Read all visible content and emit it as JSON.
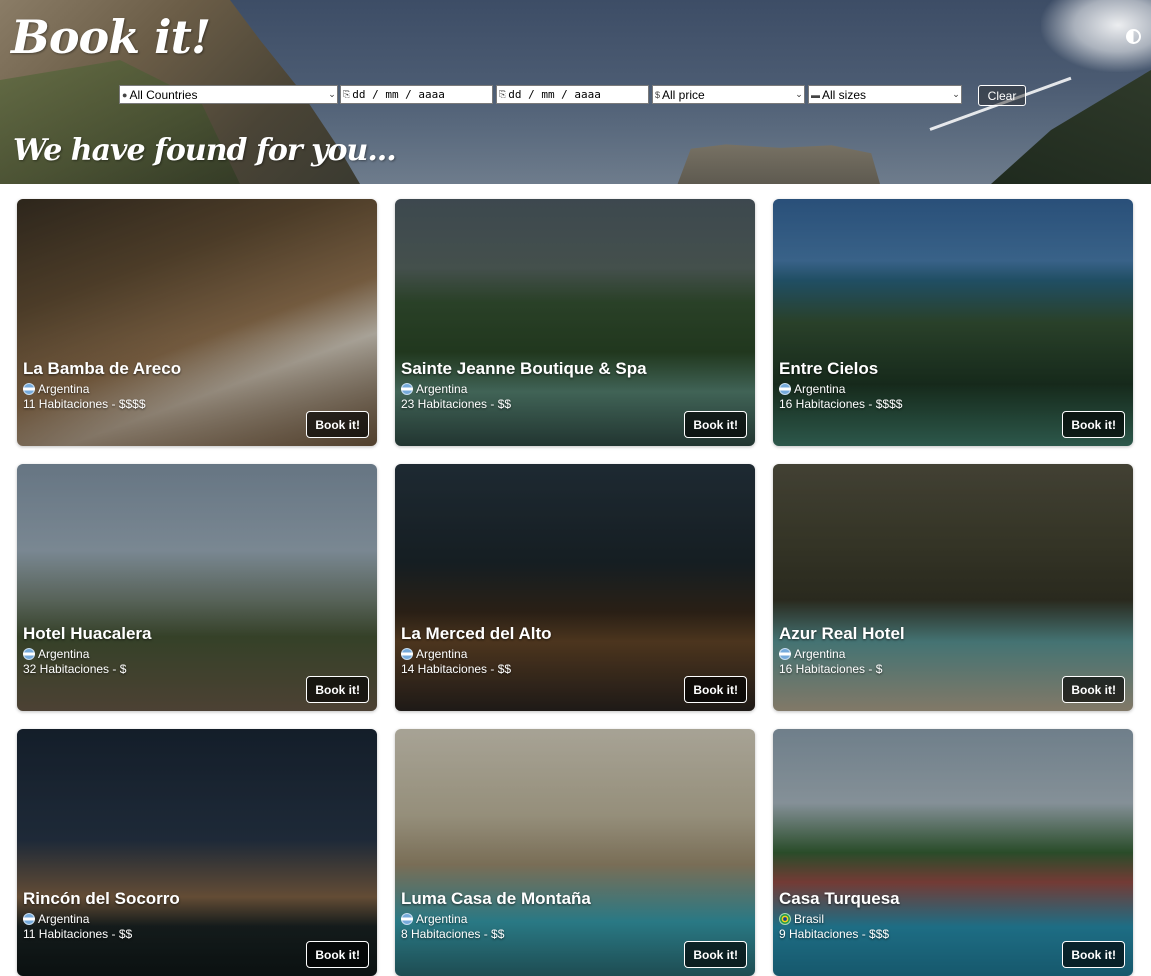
{
  "header": {
    "logo": "Book it!",
    "subtitle": "We have found for you...",
    "theme_toggle_icon": "contrast-icon"
  },
  "filters": {
    "country": {
      "value": "All Countries",
      "icon": "map-pin-icon"
    },
    "checkin": {
      "placeholder": "dd / mm / aaaa",
      "icon": "door-in-icon"
    },
    "checkout": {
      "placeholder": "dd / mm / aaaa",
      "icon": "door-out-icon"
    },
    "price": {
      "value": "All price",
      "icon": "dollar-icon"
    },
    "size": {
      "value": "All sizes",
      "icon": "bed-icon"
    },
    "clear_label": "Clear"
  },
  "hotels": [
    {
      "name": "La Bamba de Areco",
      "country": "Argentina",
      "flag": "argentina-flag-icon",
      "info": "11 Habitaciones - $$$$",
      "cta": "Book it!"
    },
    {
      "name": "Sainte Jeanne Boutique & Spa",
      "country": "Argentina",
      "flag": "argentina-flag-icon",
      "info": "23 Habitaciones - $$",
      "cta": "Book it!"
    },
    {
      "name": "Entre Cielos",
      "country": "Argentina",
      "flag": "argentina-flag-icon",
      "info": "16 Habitaciones - $$$$",
      "cta": "Book it!"
    },
    {
      "name": "Hotel Huacalera",
      "country": "Argentina",
      "flag": "argentina-flag-icon",
      "info": "32 Habitaciones - $",
      "cta": "Book it!"
    },
    {
      "name": "La Merced del Alto",
      "country": "Argentina",
      "flag": "argentina-flag-icon",
      "info": "14 Habitaciones - $$",
      "cta": "Book it!"
    },
    {
      "name": "Azur Real Hotel",
      "country": "Argentina",
      "flag": "argentina-flag-icon",
      "info": "16 Habitaciones - $",
      "cta": "Book it!"
    },
    {
      "name": "Rincón del Socorro",
      "country": "Argentina",
      "flag": "argentina-flag-icon",
      "info": "11 Habitaciones - $$",
      "cta": "Book it!"
    },
    {
      "name": "Luma Casa de Montaña",
      "country": "Argentina",
      "flag": "argentina-flag-icon",
      "info": "8 Habitaciones - $$",
      "cta": "Book it!"
    },
    {
      "name": "Casa Turquesa",
      "country": "Brasil",
      "flag": "brazil-flag-icon",
      "info": "9 Habitaciones - $$$",
      "cta": "Book it!"
    }
  ]
}
